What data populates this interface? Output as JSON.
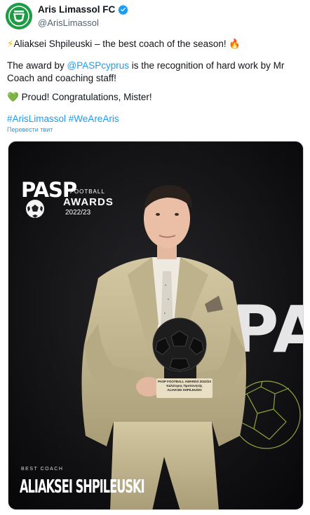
{
  "author": {
    "display_name": "Aris Limassol FC",
    "handle": "@ArisLimassol",
    "verified": true,
    "avatar_icon": "aris-limassol-crest-icon"
  },
  "tweet": {
    "line1_prefix_emoji": "⚡",
    "line1_text": "Aliaksei Shpileuski – the best coach of the season! ",
    "line1_suffix_emoji": "🔥",
    "line2_before": "The award by ",
    "line2_mention": "@PASPcyprus",
    "line2_after": " is the recognition of hard work by Mr Coach and coaching staff!",
    "line3_emoji": "💚",
    "line3_text": " Proud! Congratulations, Mister!",
    "hashtag1": "#ArisLimassol",
    "hashtag2": "#WeAreAris",
    "translate_label": "Перевести твит"
  },
  "media": {
    "logo": {
      "pasp": "PASP",
      "football": "FOOTBALL",
      "awards": "AWARDS",
      "season": "2022/23"
    },
    "caption_small": "BEST COACH",
    "caption_name": "ALIAKSEI SHPILEUSKI",
    "plaque_lines": [
      "PASP FOOTBALL AWARDS 2022/23",
      "Καλύτερος Προπονητής",
      "ALIAKSEI SHPILEUSKI"
    ],
    "backdrop_text": "PAS"
  },
  "colors": {
    "link": "#1d9bf0",
    "avatar_green": "#1e9b45",
    "suit": "#c9bd98"
  }
}
